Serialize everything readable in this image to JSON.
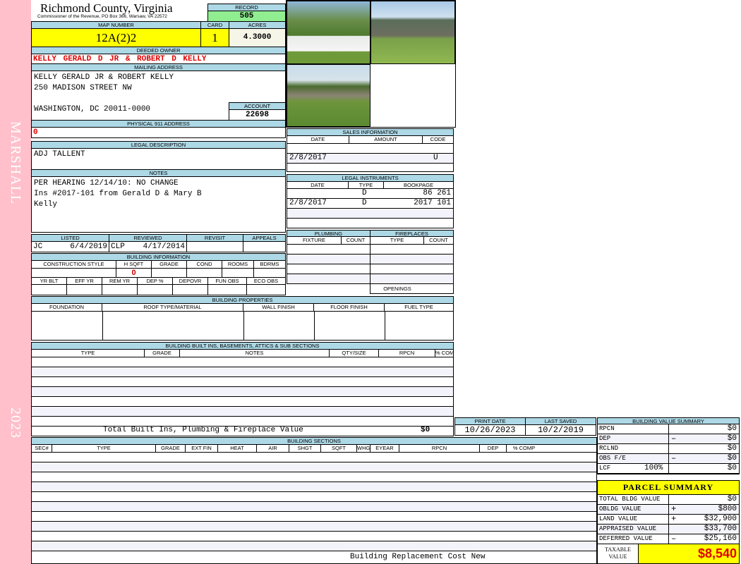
{
  "sidebar": {
    "name": "MARSHALL",
    "year": "2023"
  },
  "header": {
    "title": "Richmond County, Virginia",
    "subtitle": "Commissioner of the Revenue, PO Box 366, Warsaw, VA 22572"
  },
  "record": {
    "label": "RECORD",
    "value": "505"
  },
  "map": {
    "label": "MAP NUMBER",
    "value": "12A(2)2",
    "card_label": "CARD",
    "card": "1",
    "acres_label": "ACRES",
    "acres": "4.3000"
  },
  "owner": {
    "label": "DEEDED OWNER",
    "value": "KELLY GERALD D JR & ROBERT D KELLY"
  },
  "mailing": {
    "label": "MAILING ADDRESS",
    "line1": "KELLY GERALD JR & ROBERT KELLY",
    "line2": "250 MADISON STREET NW",
    "line3": "WASHINGTON, DC 20011-0000"
  },
  "account": {
    "label": "ACCOUNT",
    "value": "22698"
  },
  "physical": {
    "label": "PHYSICAL 911 ADDRESS",
    "value": "0"
  },
  "legal": {
    "label": "LEGAL DESCRIPTION",
    "value": "ADJ TALLENT"
  },
  "notes": {
    "label": "NOTES",
    "line1": "PER HEARING 12/14/10: NO CHANGE",
    "line2": "Ins #2017-101 from Gerald D & Mary B",
    "line3": "Kelly"
  },
  "review": {
    "listed_label": "LISTED",
    "listed_by": "JC",
    "listed_date": "6/4/2019",
    "reviewed_label": "REVIEWED",
    "reviewed_by": "CLP",
    "reviewed_date": "4/17/2014",
    "revisit_label": "REVISIT",
    "appeals_label": "APPEALS"
  },
  "building_info": {
    "label": "BUILDING INFORMATION",
    "cols1": [
      "CONSTRUCTION STYLE",
      "H SQFT",
      "GRADE",
      "COND",
      "ROOMS",
      "BDRMS"
    ],
    "hsqft": "0",
    "cols2": [
      "YR BLT",
      "EFF YR",
      "REM YR",
      "DEP %",
      "DEPOVR",
      "FUN OBS",
      "ECO OBS"
    ]
  },
  "sales": {
    "label": "SALES INFORMATION",
    "cols": [
      "DATE",
      "AMOUNT",
      "CODE"
    ],
    "rows": [
      {
        "date": "",
        "amount": "",
        "code": ""
      },
      {
        "date": "2/8/2017",
        "amount": "",
        "code": "U"
      },
      {
        "date": "",
        "amount": "",
        "code": ""
      }
    ]
  },
  "instruments": {
    "label": "LEGAL INSTRUMENTS",
    "cols": [
      "DATE",
      "TYPE",
      "BOOKPAGE"
    ],
    "rows": [
      {
        "date": "",
        "type": "D",
        "book": "86 261"
      },
      {
        "date": "2/8/2017",
        "type": "D",
        "book": "2017 101"
      }
    ]
  },
  "plumbing": {
    "label": "PLUMBING",
    "cols": [
      "FIXTURE",
      "COUNT"
    ]
  },
  "fireplaces": {
    "label": "FIREPLACES",
    "cols": [
      "TYPE",
      "COUNT"
    ],
    "openings": "OPENINGS"
  },
  "properties": {
    "label": "BUILDING PROPERTIES",
    "cols": [
      "FOUNDATION",
      "ROOF TYPE/MATERIAL",
      "WALL FINISH",
      "FLOOR FINISH",
      "FUEL TYPE"
    ]
  },
  "builtins": {
    "label": "BUILDING BUILT INS, BASEMENTS, ATTICS & SUB SECTIONS",
    "cols": [
      "TYPE",
      "GRADE",
      "NOTES",
      "QTY/SIZE",
      "RPCN",
      "% COMP"
    ],
    "total_label": "Total Built Ins, Plumbing & Fireplace Value",
    "total": "$0"
  },
  "dates": {
    "print_label": "PRINT DATE",
    "print": "10/26/2023",
    "saved_label": "LAST SAVED",
    "saved": "10/2/2019"
  },
  "sections": {
    "label": "BUILDING SECTIONS",
    "cols": [
      "SEC#",
      "TYPE",
      "GRADE",
      "EXT FIN",
      "HEAT",
      "AIR",
      "SHGT",
      "SQFT",
      "WHGT",
      "EYEAR",
      "RPCN",
      "DEP",
      "% COMP"
    ],
    "footer": "Building Replacement Cost New"
  },
  "bvs": {
    "label": "BUILDING VALUE SUMMARY",
    "rows": [
      {
        "label": "RPCN",
        "sign": "",
        "value": "$0"
      },
      {
        "label": "DEP",
        "sign": "–",
        "value": "$0"
      },
      {
        "label": "RCLND",
        "sign": "",
        "value": "$0"
      },
      {
        "label": "OBS F/E",
        "sign": "–",
        "value": "$0"
      },
      {
        "label": "LCF",
        "pct": "100%",
        "sign": "",
        "value": "$0"
      }
    ]
  },
  "parcel": {
    "label": "PARCEL SUMMARY",
    "rows": [
      {
        "label": "TOTAL BLDG VALUE",
        "sign": "",
        "value": "$0"
      },
      {
        "label": "OBLDG VALUE",
        "sign": "+",
        "value": "$800"
      },
      {
        "label": "LAND VALUE",
        "sign": "+",
        "value": "$32,900"
      },
      {
        "label": "APPRAISED VALUE",
        "sign": "",
        "value": "$33,700"
      },
      {
        "label": "DEFERRED VALUE",
        "sign": "–",
        "value": "$25,160"
      }
    ],
    "taxable_label1": "TAXABLE",
    "taxable_label2": "VALUE",
    "taxable": "$8,540"
  },
  "colors": {
    "header_bg": "#add8e6",
    "yellow": "#ffff00",
    "record_green": "#90ee90",
    "red": "#e00000",
    "pink": "#ffc0cb"
  }
}
